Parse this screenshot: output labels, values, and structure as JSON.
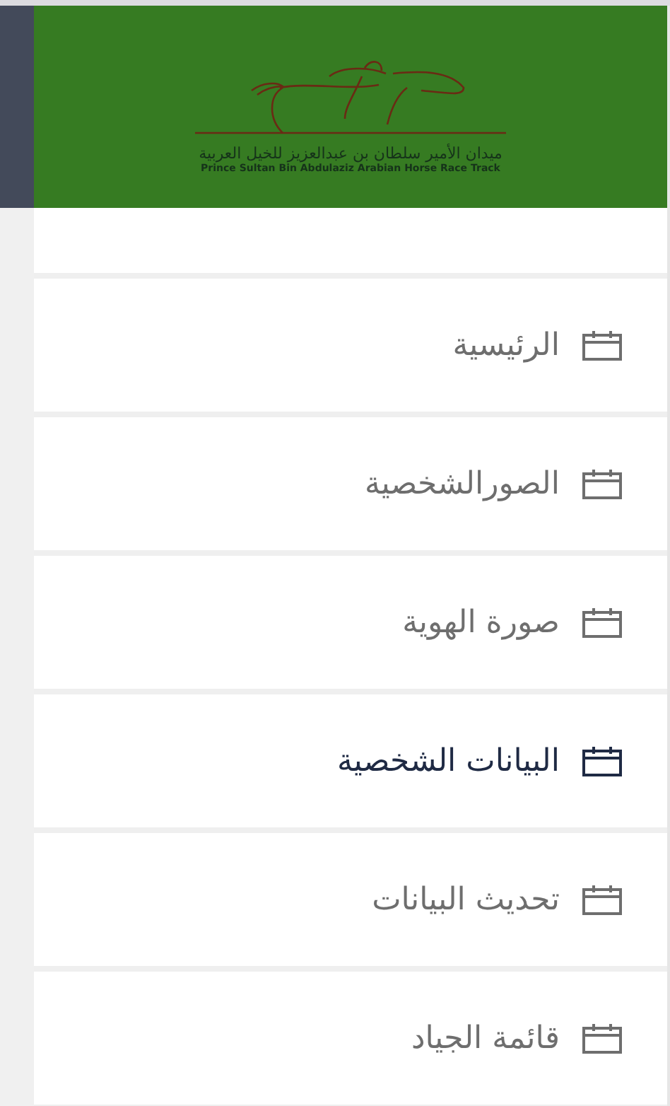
{
  "header": {
    "logo_title": "ميدان الأمير سلطان بن عبدالعزيز للخيل العربية",
    "logo_subtitle": "Prince Sultan Bin Abdulaziz Arabian Horse Race Track"
  },
  "menu": [
    {
      "label": "الرئيسية",
      "selected": false
    },
    {
      "label": "الصورالشخصية",
      "selected": false
    },
    {
      "label": "صورة الهوية",
      "selected": false
    },
    {
      "label": "البيانات الشخصية",
      "selected": true
    },
    {
      "label": "تحديث البيانات",
      "selected": false
    },
    {
      "label": "قائمة الجياد",
      "selected": false
    }
  ]
}
